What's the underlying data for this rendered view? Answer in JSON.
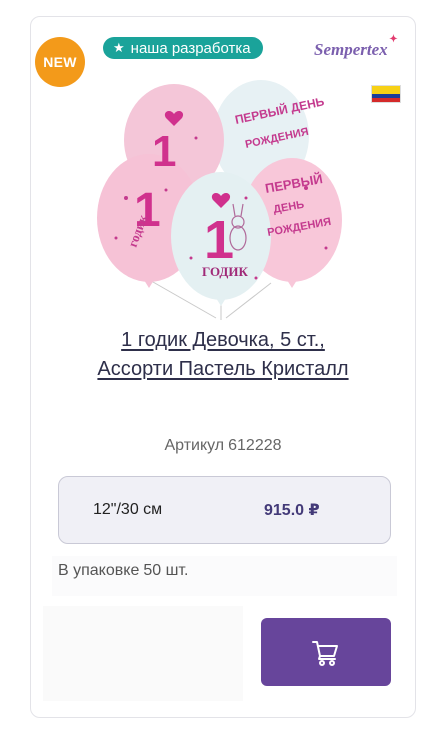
{
  "badges": {
    "new": "NEW",
    "development": "наша разработка",
    "development_icon": "star-icon"
  },
  "brand": {
    "name": "Sempertex"
  },
  "origin": {
    "flag_icon": "colombia-flag-icon"
  },
  "product": {
    "title_line1": "1 годик Девочка, 5 ст.,",
    "title_line2": "Ассорти Пастель Кристалл",
    "image_texts": {
      "birthday": "Первый день рождения",
      "one": "1",
      "year_word": "годик"
    },
    "sku_label": "Артикул",
    "sku": "612228",
    "size": "12\"/30 см",
    "price": "915.0 ₽",
    "pack_label": "В упаковке",
    "pack_count": "50 шт."
  },
  "actions": {
    "cart_icon": "cart-icon"
  },
  "colors": {
    "accent": "#67459b",
    "new_badge": "#f39a1a",
    "dev_badge": "#1aa39a",
    "price": "#433a78"
  }
}
